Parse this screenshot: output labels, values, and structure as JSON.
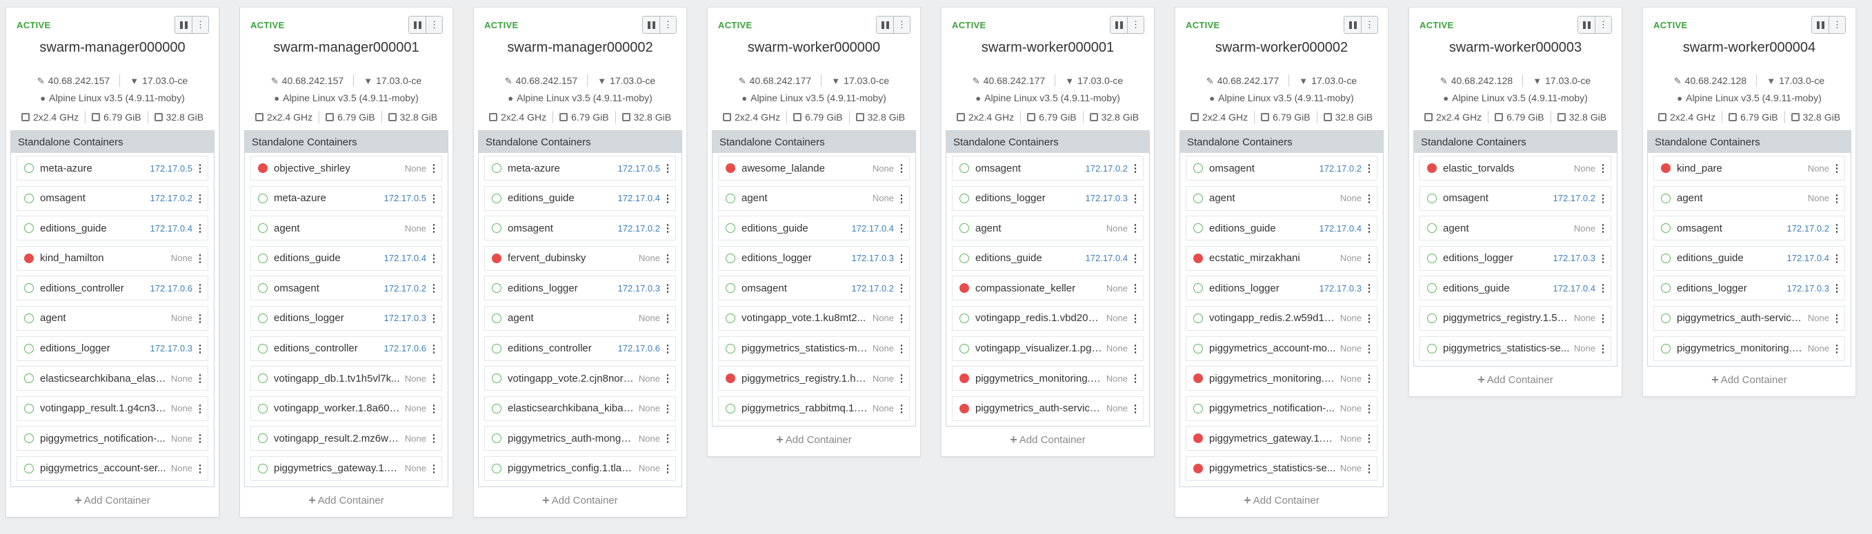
{
  "nodes": [
    {
      "status": "ACTIVE",
      "name": "swarm-manager000000",
      "ip": "40.68.242.157",
      "docker_version": "17.03.0-ce",
      "os": "Alpine Linux v3.5 (4.9.11-moby)",
      "cpu": "2x2.4 GHz",
      "memory": "6.79 GiB",
      "disk": "32.8 GiB",
      "section_title": "Standalone Containers",
      "add_label": "Add Container",
      "containers": [
        {
          "name": "meta-azure",
          "ip": "172.17.0.5",
          "state": "running"
        },
        {
          "name": "omsagent",
          "ip": "172.17.0.2",
          "state": "running"
        },
        {
          "name": "editions_guide",
          "ip": "172.17.0.4",
          "state": "running"
        },
        {
          "name": "kind_hamilton",
          "ip": "None",
          "state": "stopped"
        },
        {
          "name": "editions_controller",
          "ip": "172.17.0.6",
          "state": "running"
        },
        {
          "name": "agent",
          "ip": "None",
          "state": "running"
        },
        {
          "name": "editions_logger",
          "ip": "172.17.0.3",
          "state": "running"
        },
        {
          "name": "elasticsearchkibana_elasti...",
          "ip": "None",
          "state": "running"
        },
        {
          "name": "votingapp_result.1.g4cn3r...",
          "ip": "None",
          "state": "running"
        },
        {
          "name": "piggymetrics_notification-...",
          "ip": "None",
          "state": "running"
        },
        {
          "name": "piggymetrics_account-ser...",
          "ip": "None",
          "state": "running"
        }
      ]
    },
    {
      "status": "ACTIVE",
      "name": "swarm-manager000001",
      "ip": "40.68.242.157",
      "docker_version": "17.03.0-ce",
      "os": "Alpine Linux v3.5 (4.9.11-moby)",
      "cpu": "2x2.4 GHz",
      "memory": "6.79 GiB",
      "disk": "32.8 GiB",
      "section_title": "Standalone Containers",
      "add_label": "Add Container",
      "containers": [
        {
          "name": "objective_shirley",
          "ip": "None",
          "state": "stopped"
        },
        {
          "name": "meta-azure",
          "ip": "172.17.0.5",
          "state": "running"
        },
        {
          "name": "agent",
          "ip": "None",
          "state": "running"
        },
        {
          "name": "editions_guide",
          "ip": "172.17.0.4",
          "state": "running"
        },
        {
          "name": "omsagent",
          "ip": "172.17.0.2",
          "state": "running"
        },
        {
          "name": "editions_logger",
          "ip": "172.17.0.3",
          "state": "running"
        },
        {
          "name": "editions_controller",
          "ip": "172.17.0.6",
          "state": "running"
        },
        {
          "name": "votingapp_db.1.tv1h5vl7k...",
          "ip": "None",
          "state": "running"
        },
        {
          "name": "votingapp_worker.1.8a60q...",
          "ip": "None",
          "state": "running"
        },
        {
          "name": "votingapp_result.2.mz6wo...",
          "ip": "None",
          "state": "running"
        },
        {
          "name": "piggymetrics_gateway.1.g...",
          "ip": "None",
          "state": "running"
        }
      ]
    },
    {
      "status": "ACTIVE",
      "name": "swarm-manager000002",
      "ip": "40.68.242.157",
      "docker_version": "17.03.0-ce",
      "os": "Alpine Linux v3.5 (4.9.11-moby)",
      "cpu": "2x2.4 GHz",
      "memory": "6.79 GiB",
      "disk": "32.8 GiB",
      "section_title": "Standalone Containers",
      "add_label": "Add Container",
      "containers": [
        {
          "name": "meta-azure",
          "ip": "172.17.0.5",
          "state": "running"
        },
        {
          "name": "editions_guide",
          "ip": "172.17.0.4",
          "state": "running"
        },
        {
          "name": "omsagent",
          "ip": "172.17.0.2",
          "state": "running"
        },
        {
          "name": "fervent_dubinsky",
          "ip": "None",
          "state": "stopped"
        },
        {
          "name": "editions_logger",
          "ip": "172.17.0.3",
          "state": "running"
        },
        {
          "name": "agent",
          "ip": "None",
          "state": "running"
        },
        {
          "name": "editions_controller",
          "ip": "172.17.0.6",
          "state": "running"
        },
        {
          "name": "votingapp_vote.2.cjn8nor8...",
          "ip": "None",
          "state": "running"
        },
        {
          "name": "elasticsearchkibana_kiban...",
          "ip": "None",
          "state": "running"
        },
        {
          "name": "piggymetrics_auth-mongo...",
          "ip": "None",
          "state": "running"
        },
        {
          "name": "piggymetrics_config.1.tlas...",
          "ip": "None",
          "state": "running"
        }
      ]
    },
    {
      "status": "ACTIVE",
      "name": "swarm-worker000000",
      "ip": "40.68.242.177",
      "docker_version": "17.03.0-ce",
      "os": "Alpine Linux v3.5 (4.9.11-moby)",
      "cpu": "2x2.4 GHz",
      "memory": "6.79 GiB",
      "disk": "32.8 GiB",
      "section_title": "Standalone Containers",
      "add_label": "Add Container",
      "containers": [
        {
          "name": "awesome_lalande",
          "ip": "None",
          "state": "stopped"
        },
        {
          "name": "agent",
          "ip": "None",
          "state": "running"
        },
        {
          "name": "editions_guide",
          "ip": "172.17.0.4",
          "state": "running"
        },
        {
          "name": "editions_logger",
          "ip": "172.17.0.3",
          "state": "running"
        },
        {
          "name": "omsagent",
          "ip": "172.17.0.2",
          "state": "running"
        },
        {
          "name": "votingapp_vote.1.ku8mt2...",
          "ip": "None",
          "state": "running"
        },
        {
          "name": "piggymetrics_statistics-mo...",
          "ip": "None",
          "state": "running"
        },
        {
          "name": "piggymetrics_registry.1.h7...",
          "ip": "None",
          "state": "stopped"
        },
        {
          "name": "piggymetrics_rabbitmq.1.n...",
          "ip": "None",
          "state": "running"
        }
      ]
    },
    {
      "status": "ACTIVE",
      "name": "swarm-worker000001",
      "ip": "40.68.242.177",
      "docker_version": "17.03.0-ce",
      "os": "Alpine Linux v3.5 (4.9.11-moby)",
      "cpu": "2x2.4 GHz",
      "memory": "6.79 GiB",
      "disk": "32.8 GiB",
      "section_title": "Standalone Containers",
      "add_label": "Add Container",
      "containers": [
        {
          "name": "omsagent",
          "ip": "172.17.0.2",
          "state": "running"
        },
        {
          "name": "editions_logger",
          "ip": "172.17.0.3",
          "state": "running"
        },
        {
          "name": "agent",
          "ip": "None",
          "state": "running"
        },
        {
          "name": "editions_guide",
          "ip": "172.17.0.4",
          "state": "running"
        },
        {
          "name": "compassionate_keller",
          "ip": "None",
          "state": "stopped"
        },
        {
          "name": "votingapp_redis.1.vbd204...",
          "ip": "None",
          "state": "running"
        },
        {
          "name": "votingapp_visualizer.1.pg7...",
          "ip": "None",
          "state": "running"
        },
        {
          "name": "piggymetrics_monitoring.1...",
          "ip": "None",
          "state": "stopped"
        },
        {
          "name": "piggymetrics_auth-service...",
          "ip": "None",
          "state": "stopped"
        }
      ]
    },
    {
      "status": "ACTIVE",
      "name": "swarm-worker000002",
      "ip": "40.68.242.177",
      "docker_version": "17.03.0-ce",
      "os": "Alpine Linux v3.5 (4.9.11-moby)",
      "cpu": "2x2.4 GHz",
      "memory": "6.79 GiB",
      "disk": "32.8 GiB",
      "section_title": "Standalone Containers",
      "add_label": "Add Container",
      "containers": [
        {
          "name": "omsagent",
          "ip": "172.17.0.2",
          "state": "running"
        },
        {
          "name": "agent",
          "ip": "None",
          "state": "running"
        },
        {
          "name": "editions_guide",
          "ip": "172.17.0.4",
          "state": "running"
        },
        {
          "name": "ecstatic_mirzakhani",
          "ip": "None",
          "state": "stopped"
        },
        {
          "name": "editions_logger",
          "ip": "172.17.0.3",
          "state": "running"
        },
        {
          "name": "votingapp_redis.2.w59d1d...",
          "ip": "None",
          "state": "running"
        },
        {
          "name": "piggymetrics_account-mo...",
          "ip": "None",
          "state": "running"
        },
        {
          "name": "piggymetrics_monitoring.1...",
          "ip": "None",
          "state": "stopped"
        },
        {
          "name": "piggymetrics_notification-...",
          "ip": "None",
          "state": "running"
        },
        {
          "name": "piggymetrics_gateway.1.k...",
          "ip": "None",
          "state": "stopped"
        },
        {
          "name": "piggymetrics_statistics-se...",
          "ip": "None",
          "state": "stopped"
        }
      ]
    },
    {
      "status": "ACTIVE",
      "name": "swarm-worker000003",
      "ip": "40.68.242.128",
      "docker_version": "17.03.0-ce",
      "os": "Alpine Linux v3.5 (4.9.11-moby)",
      "cpu": "2x2.4 GHz",
      "memory": "6.79 GiB",
      "disk": "32.8 GiB",
      "section_title": "Standalone Containers",
      "add_label": "Add Container",
      "containers": [
        {
          "name": "elastic_torvalds",
          "ip": "None",
          "state": "stopped"
        },
        {
          "name": "omsagent",
          "ip": "172.17.0.2",
          "state": "running"
        },
        {
          "name": "agent",
          "ip": "None",
          "state": "running"
        },
        {
          "name": "editions_logger",
          "ip": "172.17.0.3",
          "state": "running"
        },
        {
          "name": "editions_guide",
          "ip": "172.17.0.4",
          "state": "running"
        },
        {
          "name": "piggymetrics_registry.1.5k...",
          "ip": "None",
          "state": "running"
        },
        {
          "name": "piggymetrics_statistics-se...",
          "ip": "None",
          "state": "running"
        }
      ]
    },
    {
      "status": "ACTIVE",
      "name": "swarm-worker000004",
      "ip": "40.68.242.128",
      "docker_version": "17.03.0-ce",
      "os": "Alpine Linux v3.5 (4.9.11-moby)",
      "cpu": "2x2.4 GHz",
      "memory": "6.79 GiB",
      "disk": "32.8 GiB",
      "section_title": "Standalone Containers",
      "add_label": "Add Container",
      "containers": [
        {
          "name": "kind_pare",
          "ip": "None",
          "state": "stopped"
        },
        {
          "name": "agent",
          "ip": "None",
          "state": "running"
        },
        {
          "name": "omsagent",
          "ip": "172.17.0.2",
          "state": "running"
        },
        {
          "name": "editions_guide",
          "ip": "172.17.0.4",
          "state": "running"
        },
        {
          "name": "editions_logger",
          "ip": "172.17.0.3",
          "state": "running"
        },
        {
          "name": "piggymetrics_auth-service...",
          "ip": "None",
          "state": "running"
        },
        {
          "name": "piggymetrics_monitoring.1...",
          "ip": "None",
          "state": "running"
        }
      ]
    }
  ],
  "colors": {
    "active": "#3aa33a",
    "running_dot": "#5cb85c",
    "stopped_dot": "#e74c4c",
    "ip_link": "#3e7fb9",
    "panel_header_bg": "#d3d8dc",
    "page_bg": "#eceeef"
  },
  "icons": {
    "ip": "pencil-icon",
    "docker": "docker-whale-icon",
    "os": "linux-penguin-icon",
    "cpu": "cpu-icon",
    "memory": "memory-icon",
    "disk": "disk-icon",
    "pause": "pause-icon",
    "menu": "kebab-menu-icon",
    "add": "plus-icon"
  }
}
